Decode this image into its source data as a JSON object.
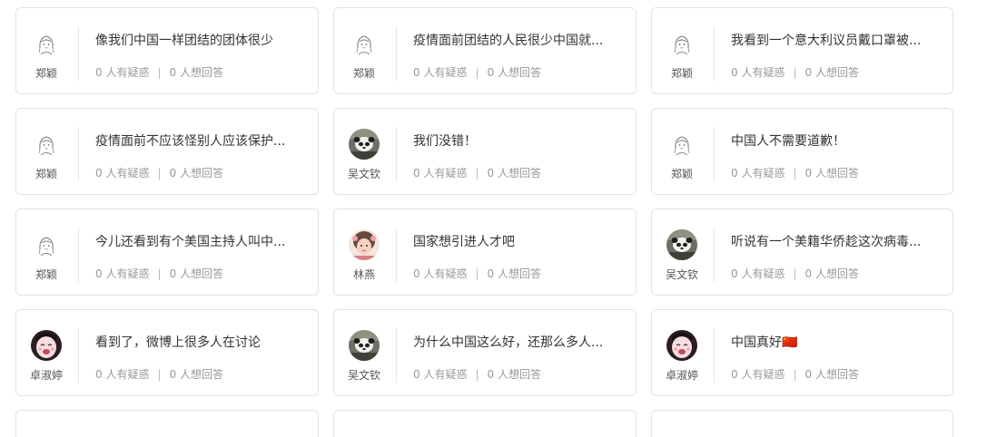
{
  "cards": [
    {
      "user": "郑颖",
      "avatar": "sketch-girl-avatar-icon",
      "title": "像我们中国一样团结的团体很少",
      "doubt": "0 人有疑惑",
      "answer": "0 人想回答"
    },
    {
      "user": "郑颖",
      "avatar": "sketch-girl-avatar-icon",
      "title": "疫情面前团结的人民很少中国就...",
      "doubt": "0 人有疑惑",
      "answer": "0 人想回答"
    },
    {
      "user": "郑颖",
      "avatar": "sketch-girl-avatar-icon",
      "title": "我看到一个意大利议员戴口罩被...",
      "doubt": "0 人有疑惑",
      "answer": "0 人想回答"
    },
    {
      "user": "郑颖",
      "avatar": "sketch-girl-avatar-icon",
      "title": "疫情面前不应该怪别人应该保护...",
      "doubt": "0 人有疑惑",
      "answer": "0 人想回答"
    },
    {
      "user": "吴文钦",
      "avatar": "panda-avatar-icon",
      "title": "我们没错！",
      "doubt": "0 人有疑惑",
      "answer": "0 人想回答"
    },
    {
      "user": "郑颖",
      "avatar": "sketch-girl-avatar-icon",
      "title": "中国人不需要道歉！",
      "doubt": "0 人有疑惑",
      "answer": "0 人想回答"
    },
    {
      "user": "郑颖",
      "avatar": "sketch-girl-avatar-icon",
      "title": "今儿还看到有个美国主持人叫中...",
      "doubt": "0 人有疑惑",
      "answer": "0 人想回答"
    },
    {
      "user": "林燕",
      "avatar": "child-photo-avatar-icon",
      "title": "国家想引进人才吧",
      "doubt": "0 人有疑惑",
      "answer": "0 人想回答"
    },
    {
      "user": "吴文钦",
      "avatar": "panda-avatar-icon",
      "title": "听说有一个美籍华侨趁这次病毒...",
      "doubt": "0 人有疑惑",
      "answer": "0 人想回答"
    },
    {
      "user": "卓淑婷",
      "avatar": "crying-girl-avatar-icon",
      "title": "看到了，微博上很多人在讨论",
      "doubt": "0 人有疑惑",
      "answer": "0 人想回答"
    },
    {
      "user": "吴文钦",
      "avatar": "panda-avatar-icon",
      "title": "为什么中国这么好，还那么多人...",
      "doubt": "0 人有疑惑",
      "answer": "0 人想回答"
    },
    {
      "user": "卓淑婷",
      "avatar": "crying-girl-avatar-icon",
      "title": "中国真好🇨🇳",
      "doubt": "0 人有疑惑",
      "answer": "0 人想回答"
    }
  ],
  "separator": "|"
}
